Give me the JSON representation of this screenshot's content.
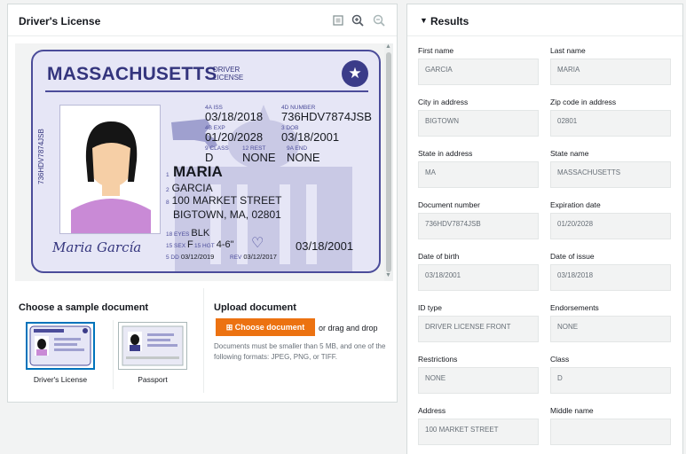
{
  "left_panel": {
    "title": "Driver's License",
    "license": {
      "state": "MASSACHUSETTS",
      "doc_type": "DRIVER LICENSE",
      "side_id": "736HDV7874JSB",
      "iss_key": "4a ISS",
      "iss": "03/18/2018",
      "number_key": "4d NUMBER",
      "number": "736HDV7874JSB",
      "exp_key": "4b EXP",
      "exp": "01/20/2028",
      "dob_key": "3 DOB",
      "dob": "03/18/2001",
      "class_key": "9 CLASS",
      "class": "D",
      "rest_key": "12 REST",
      "rest": "NONE",
      "end_key": "9a END",
      "end": "NONE",
      "first_name": "MARIA",
      "last_name_key": "2",
      "last_name": "GARCIA",
      "address_key": "8",
      "address": "100 MARKET STREET",
      "city_line": "BIGTOWN, MA, 02801",
      "eyes_key": "18 EYES",
      "eyes": "BLK",
      "sex_key": "15 SEX",
      "sex": "F",
      "hgt_key": "15 HGT",
      "hgt": "4-6\"",
      "dd_key": "5 DD",
      "dd": "03/12/2019",
      "rev_key": "REV",
      "rev": "03/12/2017",
      "dob_big": "03/18/2001",
      "signature": "Maria García",
      "num_4a": "4a",
      "num_1": "1"
    },
    "sample_title": "Choose a sample document",
    "samples": [
      {
        "label": "Driver's License",
        "selected": true
      },
      {
        "label": "Passport",
        "selected": false
      }
    ],
    "upload": {
      "title": "Upload document",
      "button": "Choose document",
      "drag": "or drag and drop",
      "help": "Documents must be smaller than 5 MB, and one of the following formats: JPEG, PNG, or TIFF."
    }
  },
  "results": {
    "title": "Results",
    "fields": [
      {
        "label": "First name",
        "value": "GARCIA"
      },
      {
        "label": "Last name",
        "value": "MARIA"
      },
      {
        "label": "City in address",
        "value": "BIGTOWN"
      },
      {
        "label": "Zip code in address",
        "value": "02801"
      },
      {
        "label": "State in address",
        "value": "MA"
      },
      {
        "label": "State name",
        "value": "MASSACHUSETTS"
      },
      {
        "label": "Document number",
        "value": "736HDV7874JSB"
      },
      {
        "label": "Expiration date",
        "value": "01/20/2028"
      },
      {
        "label": "Date of birth",
        "value": "03/18/2001"
      },
      {
        "label": "Date of issue",
        "value": "03/18/2018"
      },
      {
        "label": "ID type",
        "value": "DRIVER LICENSE FRONT"
      },
      {
        "label": "Endorsements",
        "value": "NONE"
      },
      {
        "label": "Restrictions",
        "value": "NONE"
      },
      {
        "label": "Class",
        "value": "D"
      },
      {
        "label": "Address",
        "value": "100 MARKET STREET"
      },
      {
        "label": "Middle name",
        "value": ""
      }
    ]
  },
  "colors": {
    "accent": "#ec7211",
    "card_border": "#4b4c9a",
    "selected": "#0073bb"
  },
  "icons": [
    "fit-icon",
    "zoom-in-icon",
    "zoom-out-icon",
    "star-icon",
    "heart-icon",
    "caret-down-icon"
  ]
}
